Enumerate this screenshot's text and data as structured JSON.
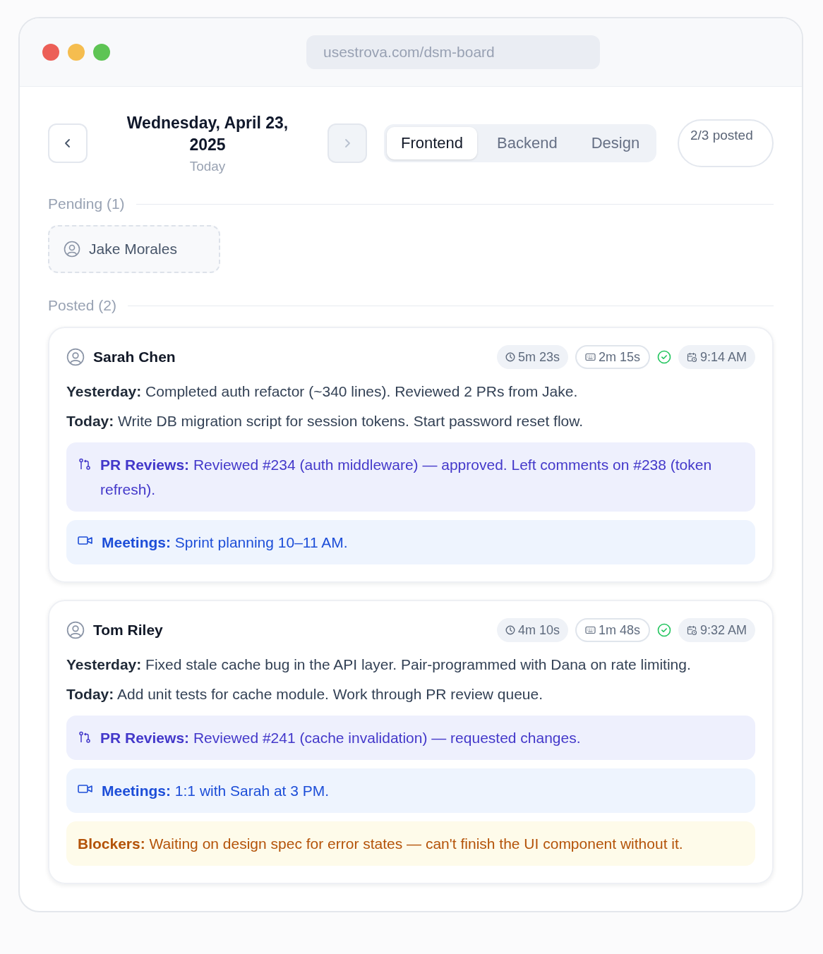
{
  "browser": {
    "url": "usestrova.com/dsm-board"
  },
  "header": {
    "date": "Wednesday, April 23, 2025",
    "subtitle": "Today",
    "prev_disabled": false,
    "next_disabled": true,
    "tabs": [
      {
        "label": "Frontend",
        "selected": true
      },
      {
        "label": "Backend",
        "selected": false
      },
      {
        "label": "Design",
        "selected": false
      }
    ],
    "posted_count": "2/3 posted"
  },
  "pending": {
    "title": "Pending (1)",
    "people": [
      "Jake Morales"
    ]
  },
  "posted": {
    "title": "Posted (2)",
    "entries": [
      {
        "name": "Sarah Chen",
        "chips": [
          {
            "kind": "duration",
            "text": "5m 23s"
          },
          {
            "kind": "typing",
            "text": "2m 15s"
          }
        ],
        "verified": true,
        "time": "9:14 AM",
        "yesterday_label": "Yesterday:",
        "yesterday": "Completed auth refactor (~340 lines). Reviewed 2 PRs from Jake.",
        "today_label": "Today:",
        "today": "Write DB migration script for session tokens. Start password reset flow.",
        "notes": [
          {
            "kind": "pr",
            "label": "PR Reviews:",
            "text": "Reviewed #234 (auth middleware) — approved. Left comments on #238 (token refresh)."
          },
          {
            "kind": "meeting",
            "label": "Meetings:",
            "text": "Sprint planning 10–11 AM."
          }
        ]
      },
      {
        "name": "Tom Riley",
        "chips": [
          {
            "kind": "duration",
            "text": "4m 10s"
          },
          {
            "kind": "typing",
            "text": "1m 48s"
          }
        ],
        "verified": true,
        "time": "9:32 AM",
        "yesterday_label": "Yesterday:",
        "yesterday": "Fixed stale cache bug in the API layer. Pair-programmed with Dana on rate limiting.",
        "today_label": "Today:",
        "today": "Add unit tests for cache module. Work through PR review queue.",
        "notes": [
          {
            "kind": "pr",
            "label": "PR Reviews:",
            "text": "Reviewed #241 (cache invalidation) — requested changes."
          },
          {
            "kind": "meeting",
            "label": "Meetings:",
            "text": "1:1 with Sarah at 3 PM."
          },
          {
            "kind": "blocker",
            "label": "Blockers:",
            "text": "Waiting on design spec for error states — can't finish the UI component without it."
          }
        ]
      }
    ]
  }
}
